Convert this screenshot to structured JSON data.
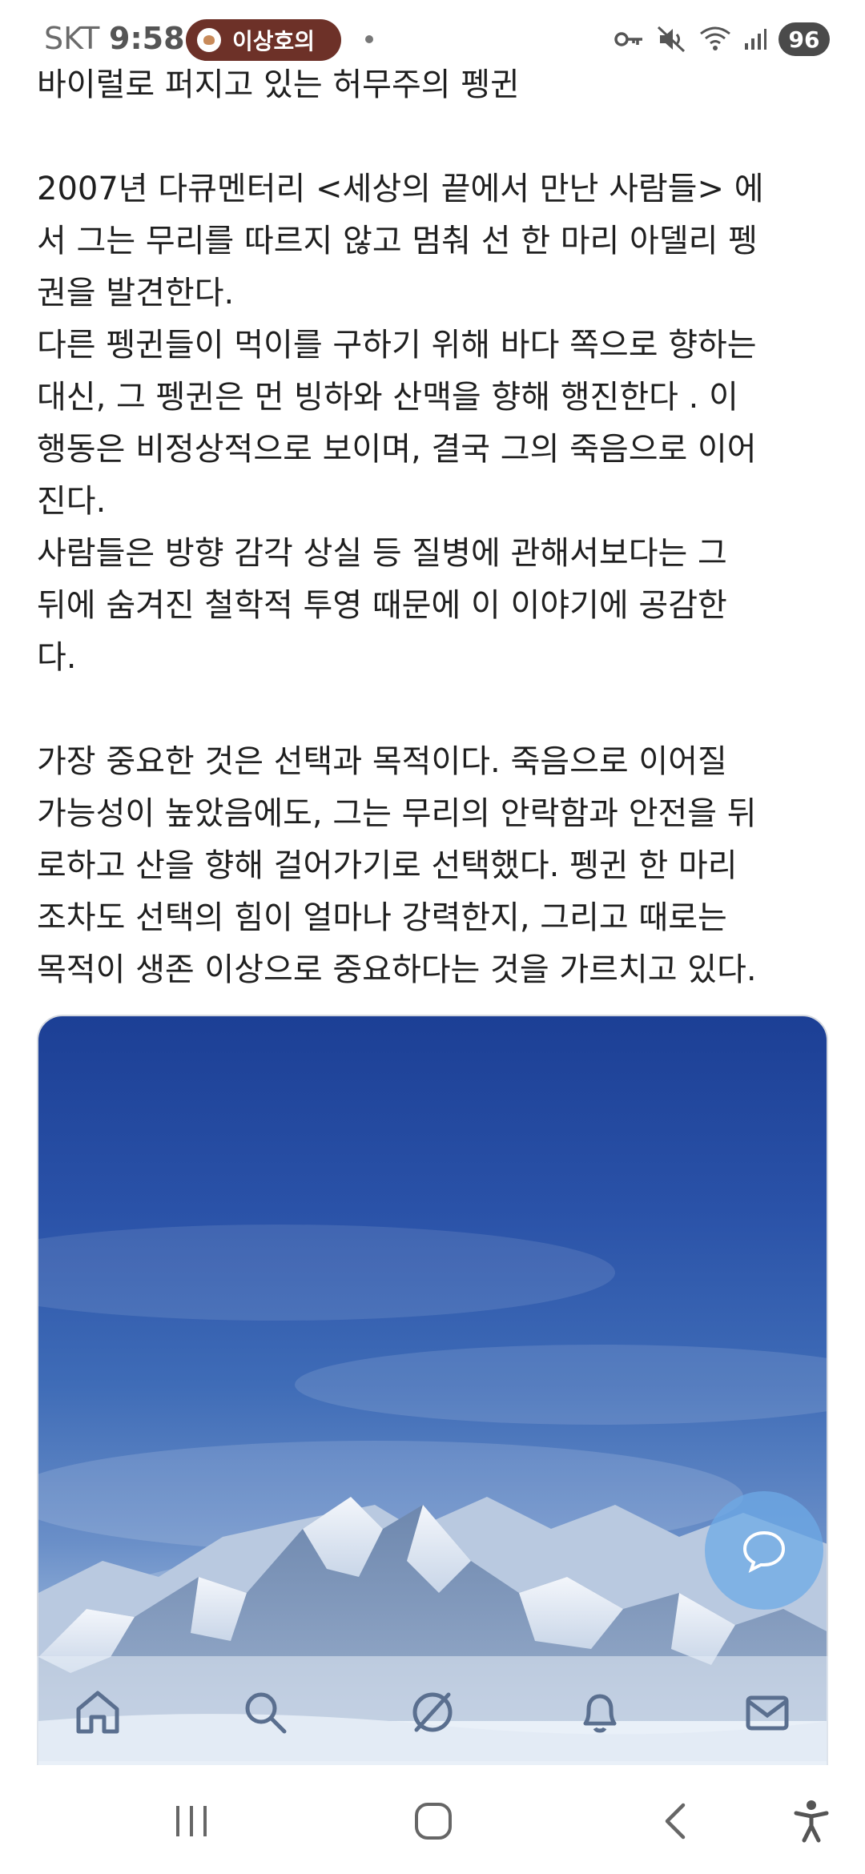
{
  "status_bar": {
    "carrier": "SKT",
    "time": "9:58",
    "notification_label": "이상호의",
    "battery": "96",
    "icons": [
      "key-icon",
      "mute-icon",
      "wifi-icon",
      "signal-icon"
    ]
  },
  "article": {
    "title_line": "바이럴로 퍼지고 있는 허무주의 펭귄",
    "paragraph_1": "2007년 다큐멘터리 <세상의 끝에서 만난 사람들> 에\n서 그는 무리를 따르지 않고 멈춰 선 한 마리 아델리 펭\n권을 발견한다.\n다른 펭귄들이 먹이를 구하기 위해 바다 쪽으로 향하는\n대신, 그 펭귄은 먼 빙하와 산맥을 향해 행진한다 . 이\n행동은 비정상적으로 보이며, 결국 그의 죽음으로 이어\n진다.\n사람들은 방향 감각 상실 등 질병에 관해서보다는 그\n뒤에 숨겨진 철학적 투영 때문에 이 이야기에 공감한\n다.",
    "paragraph_2": "가장 중요한 것은 선택과 목적이다. 죽음으로 이어질\n가능성이 높았음에도, 그는 무리의 안락함과 안전을 뒤\n로하고 산을 향해 걸어가기로 선택했다. 펭귄 한 마리\n조차도 선택의 힘이 얼마나 강력한지, 그리고 때로는\n목적이 생존 이상으로 중요하다는 것을 가르치고 있다."
  },
  "colors": {
    "accent_pill": "#6d3128",
    "sky_top": "#1c3f95",
    "chat_fab": "#6eaae6"
  },
  "bottom_nav": [
    "home-icon",
    "search-icon",
    "explore-icon",
    "notifications-icon",
    "messages-icon"
  ],
  "system_nav": [
    "recent-apps-icon",
    "home-button-icon",
    "back-icon",
    "accessibility-icon"
  ]
}
